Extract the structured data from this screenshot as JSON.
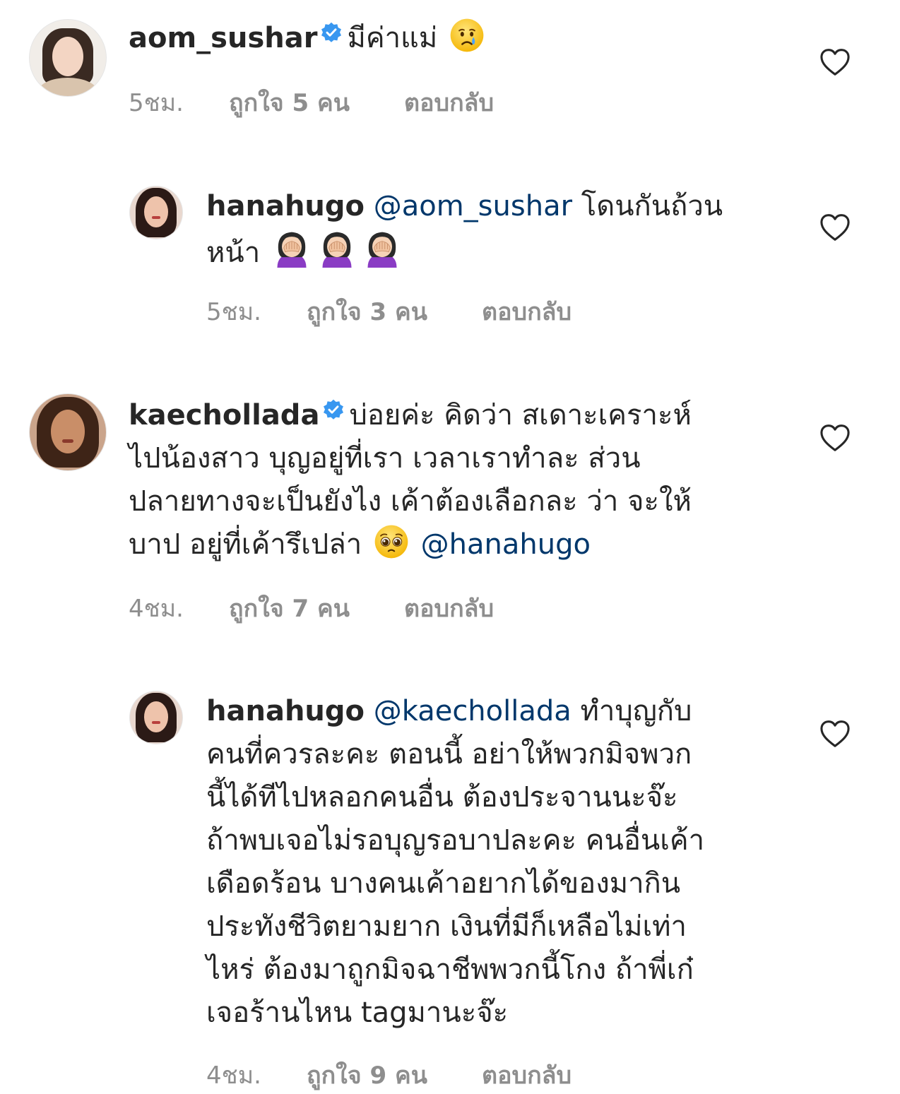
{
  "comments": [
    {
      "username": "aom_sushar",
      "verified": true,
      "mention": "",
      "text": "มีค่าแม่",
      "emoji": "crying-face",
      "time": "5ชม.",
      "likes": "ถูกใจ 5 คน",
      "reply": "ตอบกลับ",
      "is_reply": false
    },
    {
      "username": "hanahugo",
      "verified": false,
      "mention": "@aom_sushar",
      "text_line1": "โดนกันถ้วน",
      "text_line2": "หน้า",
      "emoji": "face-palm-woman",
      "time": "5ชม.",
      "likes": "ถูกใจ 3 คน",
      "reply": "ตอบกลับ",
      "is_reply": true
    },
    {
      "username": "kaechollada",
      "verified": true,
      "text_line1": "บ่อยค่ะ คิดว่า สเดาะเคราะห์",
      "text_line2": "ไปน้องสาว บุญอยู่ที่เรา เวลาเราทำละ ส่วน",
      "text_line3": "ปลายทางจะเป็นยังไง เค้าต้องเลือกละ ว่า จะให้",
      "text_line4": "บาป อยู่ที่เค้ารึเปล่า",
      "emoji": "pleading-face",
      "mention": "@hanahugo",
      "time": "4ชม.",
      "likes": "ถูกใจ 7 คน",
      "reply": "ตอบกลับ",
      "is_reply": false
    },
    {
      "username": "hanahugo",
      "verified": false,
      "mention": "@kaechollada",
      "text_line1": "ทำบุญกับ",
      "text_line2": "คนที่ควรละคะ ตอนนี้ อย่าให้พวกมิจพวก",
      "text_line3": "นี้ได้ทีไปหลอกคนอื่น ต้องประจานนะจ๊ะ",
      "text_line4": "ถ้าพบเจอไม่รอบุญรอบาปละคะ คนอื่นเค้า",
      "text_line5": "เดือดร้อน บางคนเค้าอยากได้ของมากิน",
      "text_line6": "ประทังชีวิตยามยาก เงินที่มีก็เหลือไม่เท่า",
      "text_line7": "ไหร่ ต้องมาถูกมิจฉาชีพพวกนี้โกง ถ้าพี่เก๋",
      "text_line8": "เจอร้านไหน tagมานะจ๊ะ",
      "time": "4ชม.",
      "likes": "ถูกใจ 9 คน",
      "reply": "ตอบกลับ",
      "is_reply": true
    }
  ],
  "colors": {
    "text": "#262626",
    "meta": "#8e8e8e",
    "mention": "#00376b",
    "verified": "#3897f0"
  },
  "icons": [
    "verified-badge-icon",
    "heart-icon",
    "crying-face-emoji",
    "face-palm-emoji",
    "pleading-face-emoji"
  ]
}
